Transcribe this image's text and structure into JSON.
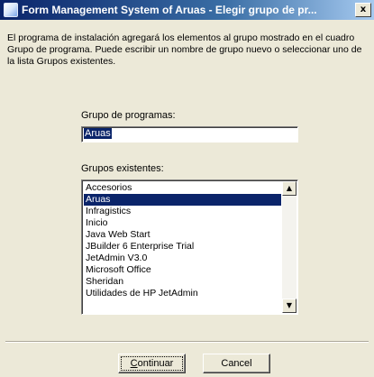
{
  "window": {
    "title": "Form Management System of Aruas - Elegir grupo de pr...",
    "close_label": "x"
  },
  "intro_text": "El programa de instalación agregará los elementos al grupo mostrado en el cuadro Grupo de programa. Puede escribir un nombre de grupo nuevo o seleccionar uno de la lista Grupos existentes.",
  "group_label": "Grupo de programas:",
  "group_value": "Aruas",
  "existing_label": "Grupos existentes:",
  "existing_groups": [
    "Accesorios",
    "Aruas",
    "Infragistics",
    "Inicio",
    "Java Web Start",
    "JBuilder 6 Enterprise Trial",
    "JetAdmin V3.0",
    "Microsoft Office",
    "Sheridan",
    "Utilidades de HP JetAdmin"
  ],
  "selected_group": "Aruas",
  "buttons": {
    "continue_label_ul": "C",
    "continue_label_rest": "ontinuar",
    "cancel_label": "Cancel"
  }
}
